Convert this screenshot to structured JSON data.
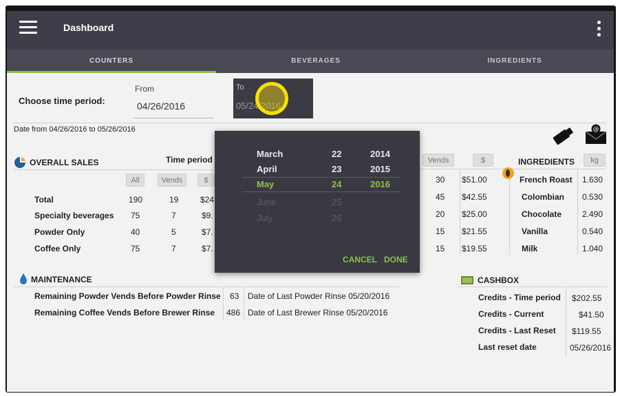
{
  "app": {
    "title": "Dashboard"
  },
  "tabs": [
    {
      "label": "COUNTERS",
      "active": true
    },
    {
      "label": "BEVERAGES",
      "active": false
    },
    {
      "label": "INGREDIENTS",
      "active": false
    }
  ],
  "period": {
    "choose_label": "Choose time period:",
    "from_label": "From",
    "from_value": "04/26/2016",
    "to_label": "To",
    "to_value": "05/24/2016",
    "range_text": "Date from 04/26/2016 to 05/26/2016"
  },
  "overall_sales": {
    "heading": "OVERALL SALES",
    "time_period_label": "Time period",
    "col_all": "All",
    "col_vends": "Vends",
    "col_dollar": "$",
    "rows": [
      {
        "label": "Total",
        "all": "190",
        "vends": "19",
        "dollar": "$24"
      },
      {
        "label": "Specialty beverages",
        "all": "75",
        "vends": "7",
        "dollar": "$9."
      },
      {
        "label": "Powder Only",
        "all": "40",
        "vends": "5",
        "dollar": "$7."
      },
      {
        "label": "Coffee Only",
        "all": "75",
        "vends": "7",
        "dollar": "$7."
      }
    ]
  },
  "right_table": {
    "col_vends": "Vends",
    "col_dollar": "$",
    "rows": [
      {
        "vends": "30",
        "dollar": "$51.00"
      },
      {
        "vends": "45",
        "dollar": "$42.55"
      },
      {
        "vends": "20",
        "dollar": "$25.00"
      },
      {
        "vends": "15",
        "dollar": "$21.55"
      },
      {
        "vends": "15",
        "dollar": "$19.55"
      }
    ]
  },
  "ingredients": {
    "heading": "INGREDIENTS",
    "col_unit": "kg",
    "rows": [
      {
        "name": "French Roast",
        "kg": "1.630"
      },
      {
        "name": "Colombian",
        "kg": "0.530"
      },
      {
        "name": "Chocolate",
        "kg": "2.490"
      },
      {
        "name": "Vanilla",
        "kg": "0.540"
      },
      {
        "name": "Milk",
        "kg": "1.040"
      }
    ]
  },
  "maintenance": {
    "heading": "MAINTENANCE",
    "rows": [
      {
        "label": "Remaining Powder Vends Before Powder Rinse",
        "value": "63",
        "note": "Date of Last Powder Rinse 05/20/2016"
      },
      {
        "label": "Remaining Coffee Vends Before Brewer Rinse",
        "value": "486",
        "note": "Date of Last Brewer Rinse 05/20/2016"
      }
    ]
  },
  "cashbox": {
    "heading": "CASHBOX",
    "rows": [
      {
        "label": "Credits - Time period",
        "value": "$202.55"
      },
      {
        "label": "Credits - Current",
        "value": "$41.50"
      },
      {
        "label": "Credits - Last Reset",
        "value": "$119.55"
      },
      {
        "label": "Last reset date",
        "value": "05/26/2016"
      }
    ]
  },
  "picker": {
    "months": [
      "March",
      "April",
      "May",
      "June",
      "July"
    ],
    "days": [
      "22",
      "23",
      "24",
      "25",
      "26"
    ],
    "years": [
      "2014",
      "2015",
      "2016"
    ],
    "cancel_label": "CANCEL",
    "done_label": "DONE"
  },
  "colors": {
    "appbar": "#3f3d49",
    "tabbar": "#4a4854",
    "accent": "#8bc34a",
    "highlight": "#f7e000"
  },
  "icons": [
    "menu-icon",
    "more-vert-icon",
    "pie-chart-icon",
    "usb-drive-icon",
    "email-icon",
    "coffee-bean-icon",
    "water-drop-icon",
    "cash-icon"
  ]
}
